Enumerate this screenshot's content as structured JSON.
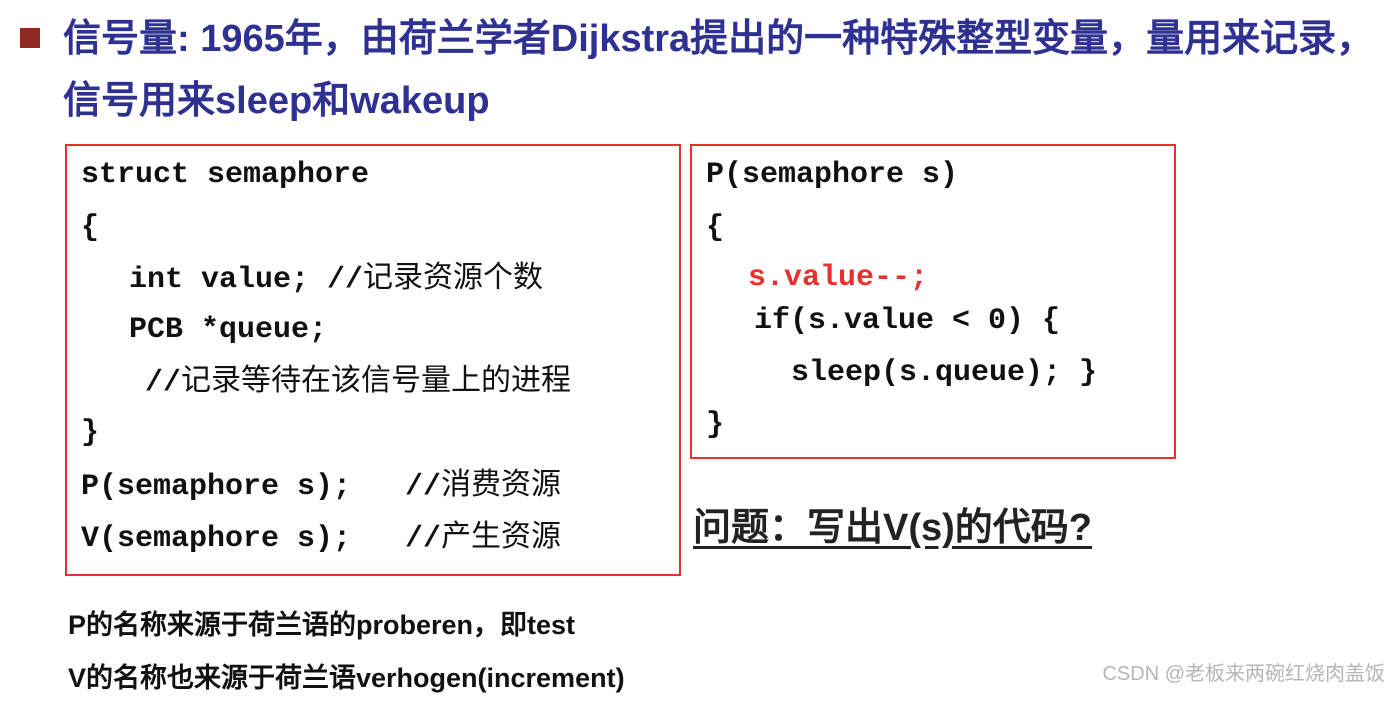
{
  "heading": {
    "text": "信号量: 1965年，由荷兰学者Dijkstra提出的一种特殊整型变量，量用来记录，信号用来sleep和wakeup"
  },
  "struct_box": {
    "line1": "struct semaphore",
    "line2": "{",
    "line3_code": "int value; //",
    "line3_comment": "记录资源个数",
    "line4": "PCB *queue;",
    "line5_code": "//",
    "line5_comment": "记录等待在该信号量上的进程",
    "line6": "}",
    "line7_code": "P(semaphore s);   //",
    "line7_comment": "消费资源",
    "line8_code": "V(semaphore s);   //",
    "line8_comment": "产生资源"
  },
  "p_box": {
    "line1": "P(semaphore s)",
    "line2": "{",
    "line3": "s.value--;",
    "line4": "if(s.value < 0) {",
    "line5": "sleep(s.queue); }",
    "line6": "}"
  },
  "question": "问题：写出V(s)的代码?",
  "notes": {
    "p_origin": "P的名称来源于荷兰语的proberen，即test",
    "v_origin": "V的名称也来源于荷兰语verhogen(increment)"
  },
  "watermark": "CSDN @老板来两碗红烧肉盖饭",
  "colors": {
    "heading": "#2e3192",
    "box_border": "#e5322d",
    "highlight": "#e5322d",
    "bullet": "#8b2a1e"
  }
}
